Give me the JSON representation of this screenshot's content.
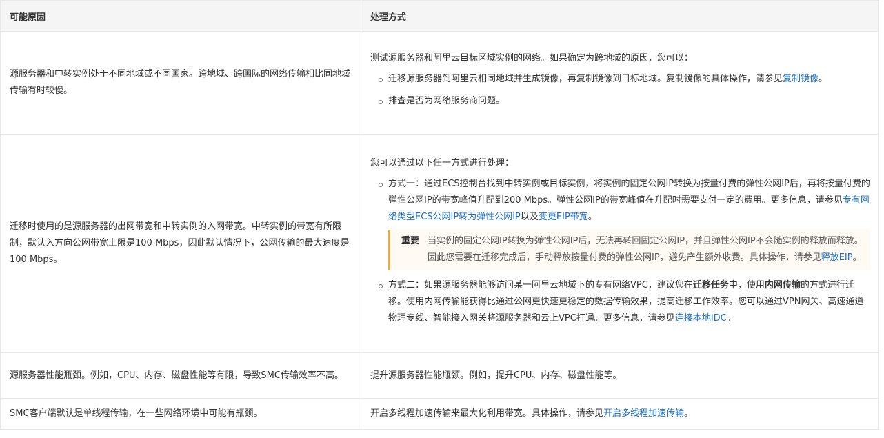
{
  "header": {
    "col1": "可能原因",
    "col2": "处理方式"
  },
  "rows": [
    {
      "cause": "源服务器和中转实例处于不同地域或不同国家。跨地域、跨国际的网络传输相比同地域传输有时较慢。",
      "intro": "测试源服务器和阿里云目标区域实例的网络。如果确定为跨地域的原因，您可以：",
      "b1_text": "迁移源服务器到阿里云相同地域并生成镜像，再复制镜像到目标地域。复制镜像的具体操作，请参见",
      "b1_link": "复制镜像",
      "b1_end": "。",
      "b2_text": "排查是否为网络服务商问题。"
    },
    {
      "cause": "迁移时使用的是源服务器的出网带宽和中转实例的入网带宽。中转实例的带宽有所限制，默认入方向公网带宽上限是100 Mbps，因此默认情况下，公网传输的最大速度是100 Mbps。",
      "intro": "您可以通过以下任一方式进行处理：",
      "m1_text": "方式一：通过ECS控制台找到中转实例或目标实例，将实例的固定公网IP转换为按量付费的弹性公网IP后，再将按量付费的弹性公网IP的带宽峰值升配到200 Mbps。弹性公网IP的带宽峰值在升配时需要支付一定的费用。更多信息，请参见",
      "m1_link1": "专有网络类型ECS公网IP转为弹性公网IP",
      "m1_mid": "以及",
      "m1_link2": "变更EIP带宽",
      "m1_end": "。",
      "note_title": "重要",
      "note_text": "当实例的固定公网IP转换为弹性公网IP后，无法再转回固定公网IP，并且弹性公网IP不会随实例的释放而释放。因此您需要在迁移完成后，手动释放按量付费的弹性公网IP，避免产生额外收费。具体操作，请参见",
      "note_link": "释放EIP",
      "note_end": "。",
      "m2_a": "方式二：如果源服务器能够访问某一阿里云地域下的专有网络VPC，建议您在",
      "m2_b1": "迁移任务",
      "m2_c": "中，使用",
      "m2_b2": "内网传输",
      "m2_d": "的方式进行迁移。使用内网传输能获得比通过公网更快速更稳定的数据传输效果，提高迁移工作效率。您可以通过VPN网关、高速通道物理专线、智能接入网关将源服务器和云上VPC打通。更多信息，请参见",
      "m2_link": "连接本地IDC",
      "m2_end": "。"
    },
    {
      "cause": "源服务器性能瓶颈。例如，CPU、内存、磁盘性能等有限，导致SMC传输效率不高。",
      "solution": "提升源服务器性能瓶颈。例如，提升CPU、内存、磁盘性能等。"
    },
    {
      "cause": "SMC客户端默认是单线程传输，在一些网络环境中可能有瓶颈。",
      "solution_text": "开启多线程加速传输来最大化利用带宽。具体操作，请参见",
      "solution_link": "开启多线程加速传输",
      "solution_end": "。"
    }
  ]
}
